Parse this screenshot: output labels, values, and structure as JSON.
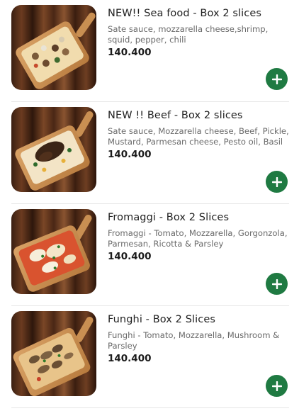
{
  "menu": {
    "items": [
      {
        "title": "NEW!! Sea food - Box 2 slices",
        "description": "Sate sauce, mozzarella cheese,shrimp, squid, pepper, chili",
        "price": "140.400",
        "image_icon": "seafood-pizza-photo",
        "add_icon": "plus-icon"
      },
      {
        "title": "NEW !! Beef - Box 2 slices",
        "description": "Sate sauce, Mozzarella cheese, Beef, Pickle, Mustard, Parmesan cheese, Pesto oil, Basil",
        "price": "140.400",
        "image_icon": "beef-pizza-photo",
        "add_icon": "plus-icon"
      },
      {
        "title": "Fromaggi - Box 2 Slices",
        "description": "Fromaggi - Tomato, Mozzarella, Gorgonzola, Parmesan, Ricotta & Parsley",
        "price": "140.400",
        "image_icon": "cheese-pizza-photo",
        "add_icon": "plus-icon"
      },
      {
        "title": "Funghi - Box 2 Slices",
        "description": "Funghi - Tomato, Mozzarella, Mushroom & Parsley",
        "price": "140.400",
        "image_icon": "mushroom-pizza-photo",
        "add_icon": "plus-icon"
      }
    ]
  },
  "colors": {
    "accent": "#1f7a42",
    "price": "#1c1c1c",
    "description": "#6a6a6a"
  }
}
